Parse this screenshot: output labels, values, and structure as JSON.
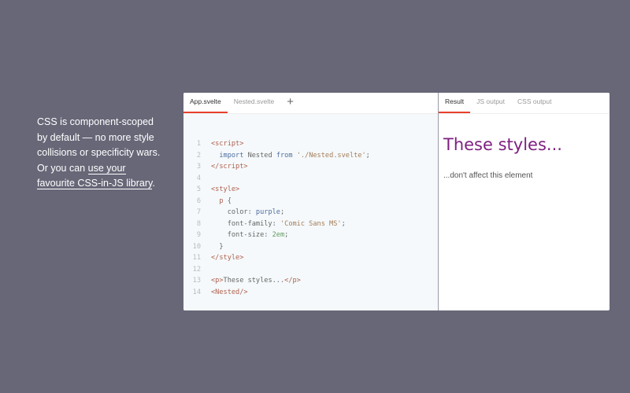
{
  "blurb": {
    "text": "CSS is component-scoped by default — no more style collisions or specificity wars. Or you can ",
    "link": "use your favourite CSS-in-JS library",
    "end": "."
  },
  "editor": {
    "tabs": [
      "App.svelte",
      "Nested.svelte"
    ],
    "add_label": "+",
    "lines": [
      [
        [
          "tag",
          "<script>"
        ]
      ],
      [
        [
          "txt",
          "  "
        ],
        [
          "kw",
          "import"
        ],
        [
          "txt",
          " Nested "
        ],
        [
          "kw",
          "from"
        ],
        [
          "str",
          " './Nested.svelte'"
        ],
        [
          "txt",
          ";"
        ]
      ],
      [
        [
          "tag",
          "</script>"
        ]
      ],
      [],
      [
        [
          "tag",
          "<style>"
        ]
      ],
      [
        [
          "tag",
          "  p"
        ],
        [
          "txt",
          " {"
        ]
      ],
      [
        [
          "txt",
          "    color: "
        ],
        [
          "kw",
          "purple"
        ],
        [
          "txt",
          ";"
        ]
      ],
      [
        [
          "txt",
          "    font-family: "
        ],
        [
          "str",
          "'Comic Sans MS'"
        ],
        [
          "txt",
          ";"
        ]
      ],
      [
        [
          "txt",
          "    font-size: "
        ],
        [
          "num",
          "2em"
        ],
        [
          "txt",
          ";"
        ]
      ],
      [
        [
          "txt",
          "  }"
        ]
      ],
      [
        [
          "tag",
          "</style>"
        ]
      ],
      [],
      [
        [
          "tag",
          "<p>"
        ],
        [
          "txt",
          "These styles..."
        ],
        [
          "tag",
          "</p>"
        ]
      ],
      [
        [
          "tag",
          "<Nested/>"
        ]
      ]
    ]
  },
  "output": {
    "tabs": [
      "Result",
      "JS output",
      "CSS output"
    ],
    "heading": "These styles...",
    "paragraph": "...don't affect this element"
  }
}
